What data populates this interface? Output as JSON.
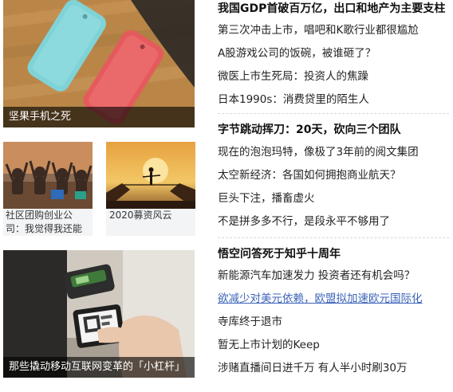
{
  "left": {
    "feature1": {
      "caption": "坚果手机之死"
    },
    "small1": {
      "caption": "社区团购创业公司：我觉得我还能"
    },
    "small2": {
      "caption": "2020募资风云"
    },
    "feature2": {
      "caption": "那些撬动移动互联网变革的「小杠杆」"
    }
  },
  "right": {
    "groups": [
      {
        "headline": "我国GDP首破百万亿，出口和地产为主要支柱",
        "items": [
          "第三次冲击上市，唱吧和K歌行业都很尴尬",
          "A股游戏公司的饭碗，被谁砸了？",
          "微医上市生死局：投资人的焦躁",
          "日本1990s：消费贷里的陌生人"
        ]
      },
      {
        "headline": "字节跳动挥刀：20天，砍向三个团队",
        "items": [
          "现在的泡泡玛特，像极了3年前的阅文集团",
          "太空新经济：各国如何拥抱商业航天？",
          "巨头下注，播畜虚火",
          "不是拼多多不行，是段永平不够用了"
        ]
      },
      {
        "headline": "悟空问答死于知乎十周年",
        "items": [
          "新能源汽车加速发力 投资者还有机会吗？",
          "欲减少对美元依赖，欧盟拟加速欧元国际化",
          "寺库终于退市",
          "暂无上市计划的Keep",
          "涉赌直播间日进千万 有人半小时刷30万"
        ]
      }
    ]
  },
  "colors": {
    "link": "#3b63b8",
    "overlay": "rgba(0,0,0,0.62)",
    "caption_bg": "#f3f4f6"
  }
}
